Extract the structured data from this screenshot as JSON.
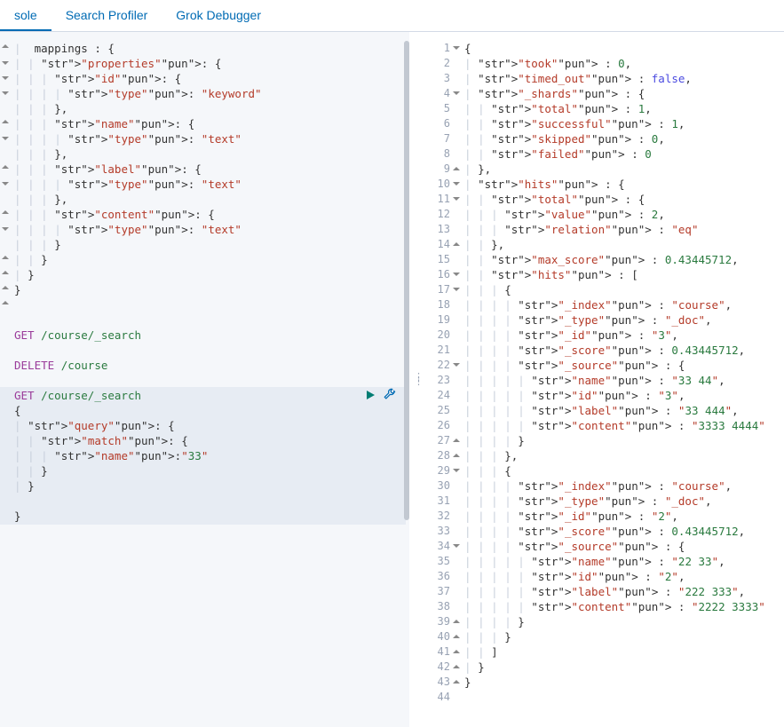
{
  "tabs": [
    {
      "label": "sole",
      "active": true
    },
    {
      "label": "Search Profiler",
      "active": false
    },
    {
      "label": "Grok Debugger",
      "active": false
    }
  ],
  "left_editor": {
    "pre_lines": [
      "   mappings : {",
      "    \"properties\": {",
      "      \"id\": {",
      "        \"type\": \"keyword\"",
      "      },",
      "      \"name\": {",
      "        \"type\": \"text\"",
      "      },",
      "      \"label\": {",
      "        \"type\": \"text\"",
      "      },",
      "      \"content\": {",
      "        \"type\": \"text\"",
      "      }",
      "    }",
      "  }",
      "}",
      "",
      "",
      "GET /course/_search",
      "",
      "DELETE /course",
      ""
    ],
    "fold_markers_pre": {
      "0": "close",
      "1": "open",
      "2": "open",
      "3": "open",
      "5": "close",
      "6": "open",
      "8": "close",
      "9": "open",
      "11": "close",
      "12": "open",
      "14": "close",
      "15": "close",
      "16": "close",
      "17": "close"
    },
    "highlighted_request": {
      "method": "GET",
      "path": "/course/_search",
      "body_lines": [
        "{",
        "  \"query\": {",
        "    \"match\": {",
        "      \"name\":\"33\"",
        "    }",
        "  }",
        "",
        "}"
      ],
      "fold_markers": {
        "0": "open",
        "1": "open",
        "2": "open",
        "4": "close",
        "5": "close",
        "7": "close"
      }
    },
    "actions": {
      "run_label": "Run request",
      "tools_label": "Options"
    }
  },
  "right_editor": {
    "lines": [
      "{",
      "  \"took\" : 0,",
      "  \"timed_out\" : false,",
      "  \"_shards\" : {",
      "    \"total\" : 1,",
      "    \"successful\" : 1,",
      "    \"skipped\" : 0,",
      "    \"failed\" : 0",
      "  },",
      "  \"hits\" : {",
      "    \"total\" : {",
      "      \"value\" : 2,",
      "      \"relation\" : \"eq\"",
      "    },",
      "    \"max_score\" : 0.43445712,",
      "    \"hits\" : [",
      "      {",
      "        \"_index\" : \"course\",",
      "        \"_type\" : \"_doc\",",
      "        \"_id\" : \"3\",",
      "        \"_score\" : 0.43445712,",
      "        \"_source\" : {",
      "          \"name\" : \"33 44\",",
      "          \"id\" : \"3\",",
      "          \"label\" : \"33 444\",",
      "          \"content\" : \"3333 4444\"",
      "        }",
      "      },",
      "      {",
      "        \"_index\" : \"course\",",
      "        \"_type\" : \"_doc\",",
      "        \"_id\" : \"2\",",
      "        \"_score\" : 0.43445712,",
      "        \"_source\" : {",
      "          \"name\" : \"22 33\",",
      "          \"id\" : \"2\",",
      "          \"label\" : \"222 333\",",
      "          \"content\" : \"2222 3333\"",
      "        }",
      "      }",
      "    ]",
      "  }",
      "}",
      ""
    ],
    "fold_markers": {
      "0": "open",
      "3": "open",
      "8": "close",
      "9": "open",
      "10": "open",
      "13": "close",
      "15": "open",
      "16": "open",
      "21": "open",
      "26": "close",
      "27": "close",
      "28": "open",
      "33": "open",
      "38": "close",
      "39": "close",
      "40": "close",
      "41": "close",
      "42": "close"
    }
  }
}
